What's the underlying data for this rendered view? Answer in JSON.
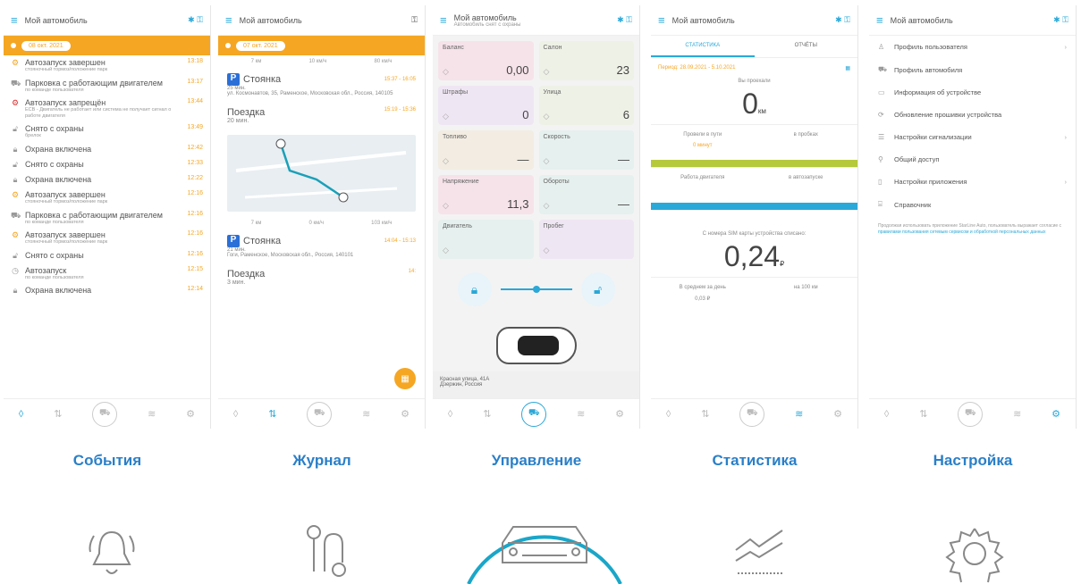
{
  "header": {
    "title": "Мой автомобиль",
    "subtitle": "Автомобиль снят с охраны"
  },
  "screens": {
    "events": {
      "date": "08 окт. 2021",
      "items": [
        {
          "title": "Автозапуск завершен",
          "desc": "стояночный тормоз/положение парк",
          "time": "13:18",
          "icon": "engine-icon",
          "tone": "o"
        },
        {
          "title": "Парковка с работающим двигателем",
          "desc": "по команде пользователя",
          "time": "13:17",
          "icon": "car-icon",
          "tone": "g"
        },
        {
          "title": "Автозапуск запрещён",
          "desc": "ECB - Двигатель не работает или система не получает сигнал о работе двигателя",
          "time": "13:44",
          "icon": "engine-off-icon",
          "tone": "r"
        },
        {
          "title": "Снято с охраны",
          "desc": "брелок",
          "time": "13:49",
          "icon": "lock-open-icon",
          "tone": "g"
        },
        {
          "title": "Охрана включена",
          "desc": "",
          "time": "12:42",
          "icon": "lock-icon",
          "tone": "g"
        },
        {
          "title": "Снято с охраны",
          "desc": "",
          "time": "12:33",
          "icon": "lock-open-icon",
          "tone": "g"
        },
        {
          "title": "Охрана включена",
          "desc": "",
          "time": "12:22",
          "icon": "lock-icon",
          "tone": "g"
        },
        {
          "title": "Автозапуск завершен",
          "desc": "стояночный тормоз/положение парк",
          "time": "12:16",
          "icon": "engine-icon",
          "tone": "o"
        },
        {
          "title": "Парковка с работающим двигателем",
          "desc": "по команде пользователя",
          "time": "12:16",
          "icon": "car-icon",
          "tone": "g"
        },
        {
          "title": "Автозапуск завершен",
          "desc": "стояночный тормоз/положение парк",
          "time": "12:16",
          "icon": "engine-icon",
          "tone": "o"
        },
        {
          "title": "Снято с охраны",
          "desc": "",
          "time": "12:16",
          "icon": "lock-open-icon",
          "tone": "g"
        },
        {
          "title": "Автозапуск",
          "desc": "по команде пользователя",
          "time": "12:15",
          "icon": "clock-icon",
          "tone": "g"
        },
        {
          "title": "Охрана включена",
          "desc": "",
          "time": "12:14",
          "icon": "lock-icon",
          "tone": "g"
        }
      ]
    },
    "journal": {
      "date": "07 окт. 2021",
      "top_stats": [
        "7 км",
        "10 км/ч",
        "80 км/ч"
      ],
      "park1": {
        "title": "Стоянка",
        "time": "15:37 - 16:05",
        "dur": "25 мин.",
        "addr": "ул. Космонавтов, 35, Раменское, Московская обл., Россия, 140105"
      },
      "trip1": {
        "title": "Поездка",
        "time": "15:19 - 15:36",
        "dur": "20 мин."
      },
      "trip_stats": [
        "7 км",
        "0 км/ч",
        "103 км/ч"
      ],
      "park2": {
        "title": "Стоянка",
        "time": "14:04 - 15:13",
        "dur": "21 мин.",
        "addr": "Гоги, Раменское, Московская обл., Россия, 140101"
      },
      "trip2": {
        "title": "Поездка",
        "time": "14:",
        "dur": "3 мин."
      }
    },
    "control": {
      "tiles": [
        {
          "label": "Баланс",
          "value": "0,00",
          "bg": "#f6e3ea"
        },
        {
          "label": "Салон",
          "value": "23",
          "bg": "#eef1e6"
        },
        {
          "label": "Штрафы",
          "value": "0",
          "bg": "#efe6f3"
        },
        {
          "label": "Улица",
          "value": "6",
          "bg": "#eef1e6"
        },
        {
          "label": "Топливо",
          "value": "—",
          "bg": "#f2ece2"
        },
        {
          "label": "Скорость",
          "value": "—",
          "bg": "#e6f0ee"
        },
        {
          "label": "Напряжение",
          "value": "11,3",
          "bg": "#f6e3ea"
        },
        {
          "label": "Обороты",
          "value": "—",
          "bg": "#e6f0ee"
        },
        {
          "label": "Двигатель",
          "value": "",
          "bg": "#e6f0ee"
        },
        {
          "label": "Пробег",
          "value": "",
          "bg": "#efe6f3"
        }
      ],
      "location": "Красная улица, 41А",
      "location2": "Дзержин, Россия"
    },
    "stats": {
      "tab1": "СТАТИСТИКА",
      "tab2": "ОТЧЁТЫ",
      "period": "Период: 28.09.2021 - 5.10.2021",
      "passed_label": "Вы проехали",
      "passed": "0",
      "passed_unit": "км",
      "way": "Провели в пути",
      "way_val": "0 минут",
      "parked": "в пробках",
      "engine": "Работа двигателя",
      "autostart": "в автозапуске",
      "spent_label": "С номера SIM карты устройства списано:",
      "spent": "0,24",
      "spent_unit": "₽",
      "avg": "В среднем за день",
      "avg_val": "0,03 ₽",
      "per100": "на 100 км"
    },
    "settings": {
      "items": [
        {
          "label": "Профиль пользователя",
          "icon": "user-icon",
          "chev": true
        },
        {
          "label": "Профиль автомобиля",
          "icon": "car-icon",
          "chev": false
        },
        {
          "label": "Информация об устройстве",
          "icon": "device-icon",
          "chev": false
        },
        {
          "label": "Обновление прошивки устройства",
          "icon": "update-icon",
          "chev": false
        },
        {
          "label": "Настройки сигнализации",
          "icon": "sliders-icon",
          "chev": true
        },
        {
          "label": "Общий доступ",
          "icon": "share-icon",
          "chev": false
        },
        {
          "label": "Настройки приложения",
          "icon": "phone-icon",
          "chev": true
        },
        {
          "label": "Справочник",
          "icon": "book-icon",
          "chev": false
        }
      ],
      "note": "Продолжая использовать приложение StarLine Auto, пользователь выражает согласие с ",
      "note_link": "правилами пользования сетевым сервисом и обработкой персональных данных"
    }
  },
  "labels": {
    "events": "События",
    "journal": "Журнал",
    "control": "Управление",
    "stats": "Статистика",
    "settings": "Настройка"
  },
  "colors": {
    "accent": "#2aa8d8",
    "orange": "#f5a623",
    "label": "#2a7fc8"
  }
}
